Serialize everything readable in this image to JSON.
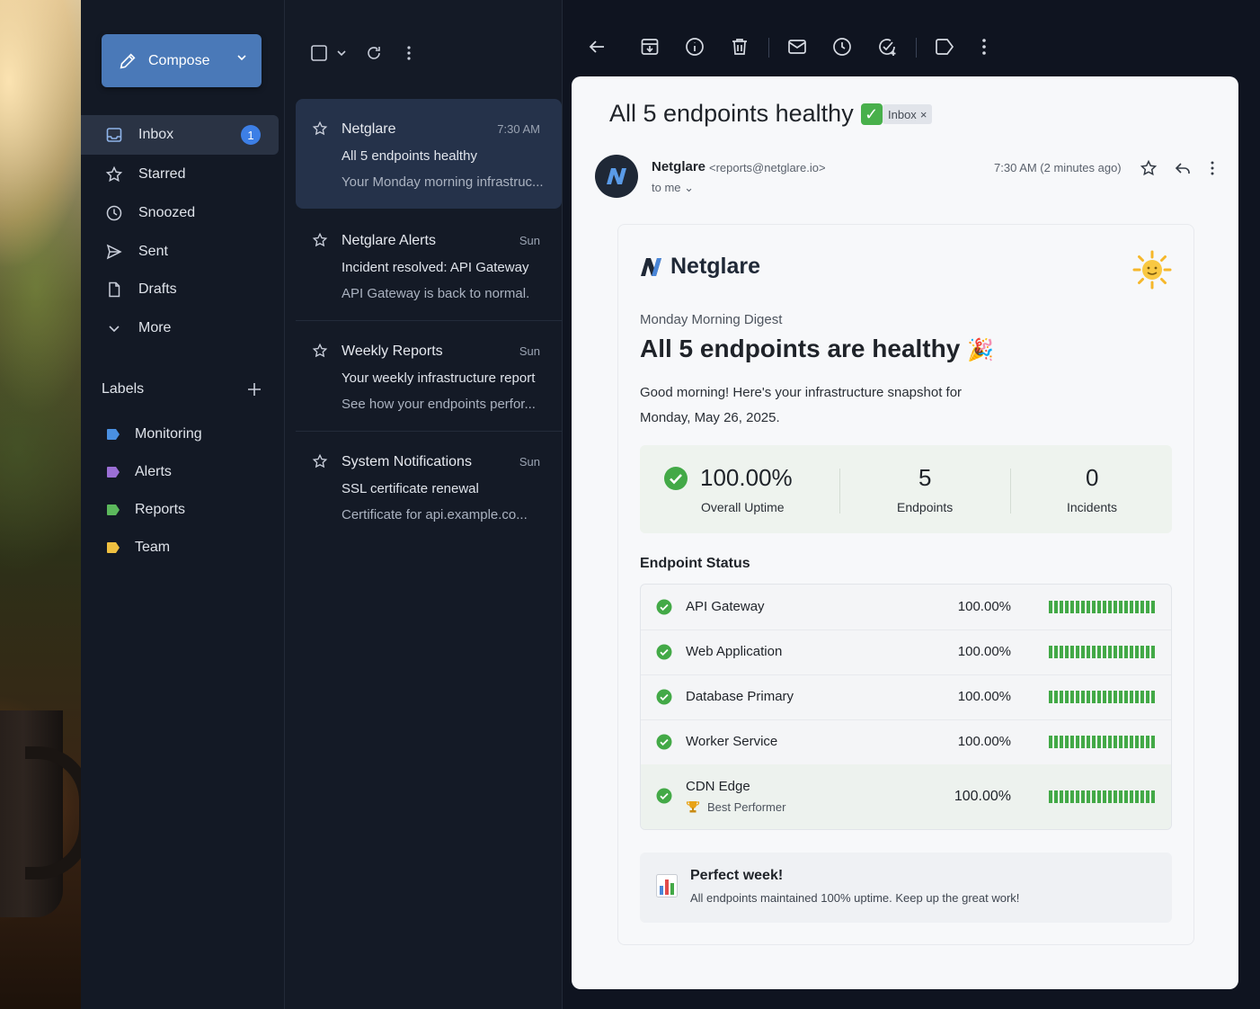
{
  "compose": {
    "label": "Compose"
  },
  "nav": [
    {
      "label": "Inbox",
      "icon": "inbox-icon",
      "badge": "1",
      "active": true
    },
    {
      "label": "Starred",
      "icon": "star-icon"
    },
    {
      "label": "Snoozed",
      "icon": "clock-icon"
    },
    {
      "label": "Sent",
      "icon": "send-icon"
    },
    {
      "label": "Drafts",
      "icon": "document-icon"
    },
    {
      "label": "More",
      "icon": "chevron-down-icon"
    }
  ],
  "labels": {
    "heading": "Labels",
    "items": [
      {
        "label": "Monitoring",
        "color": "#4a90e2"
      },
      {
        "label": "Alerts",
        "color": "#9b6fd6"
      },
      {
        "label": "Reports",
        "color": "#5cb85c"
      },
      {
        "label": "Team",
        "color": "#f0c040"
      }
    ]
  },
  "messages": [
    {
      "sender": "Netglare",
      "time": "7:30 AM",
      "subject": "All 5 endpoints healthy",
      "snippet": "Your Monday morning infrastruc...",
      "selected": true
    },
    {
      "sender": "Netglare Alerts",
      "time": "Sun",
      "subject": "Incident resolved: API Gateway",
      "snippet": "API Gateway is back to normal."
    },
    {
      "sender": "Weekly Reports",
      "time": "Sun",
      "subject": "Your weekly infrastructure report",
      "snippet": "See how your endpoints perfor..."
    },
    {
      "sender": "System Notifications",
      "time": "Sun",
      "subject": "SSL certificate renewal",
      "snippet": "Certificate for api.example.co..."
    }
  ],
  "email": {
    "subject": "All 5 endpoints healthy",
    "subject_emoji": "✓",
    "chip": "Inbox",
    "chip_close": "×",
    "from_name": "Netglare",
    "from_addr": "<reports@netglare.io>",
    "to": "to me",
    "time": "7:30 AM (2 minutes ago)",
    "avatar_letter": "N"
  },
  "body": {
    "brand": "Netglare",
    "digest_label": "Monday Morning Digest",
    "title": "All 5 endpoints are healthy",
    "title_emoji": "🎉",
    "greeting": "Good morning! Here's your infrastructure snapshot for Monday, May 26, 2025.",
    "stats": [
      {
        "value": "100.00%",
        "label": "Overall Uptime"
      },
      {
        "value": "5",
        "label": "Endpoints"
      },
      {
        "value": "0",
        "label": "Incidents"
      }
    ],
    "section_title": "Endpoint Status",
    "endpoints": [
      {
        "name": "API Gateway",
        "uptime": "100.00%"
      },
      {
        "name": "Web Application",
        "uptime": "100.00%"
      },
      {
        "name": "Database Primary",
        "uptime": "100.00%"
      },
      {
        "name": "Worker Service",
        "uptime": "100.00%"
      },
      {
        "name": "CDN Edge",
        "uptime": "100.00%",
        "sub": "Best Performer",
        "sub_icon": "trophy-icon"
      }
    ],
    "callout": {
      "title": "Perfect week!",
      "text": "All endpoints maintained 100% uptime. Keep up the great work!"
    }
  },
  "colors": {
    "accent": "#4a79b8",
    "success": "#43a947",
    "badge": "#3d7fe6"
  }
}
